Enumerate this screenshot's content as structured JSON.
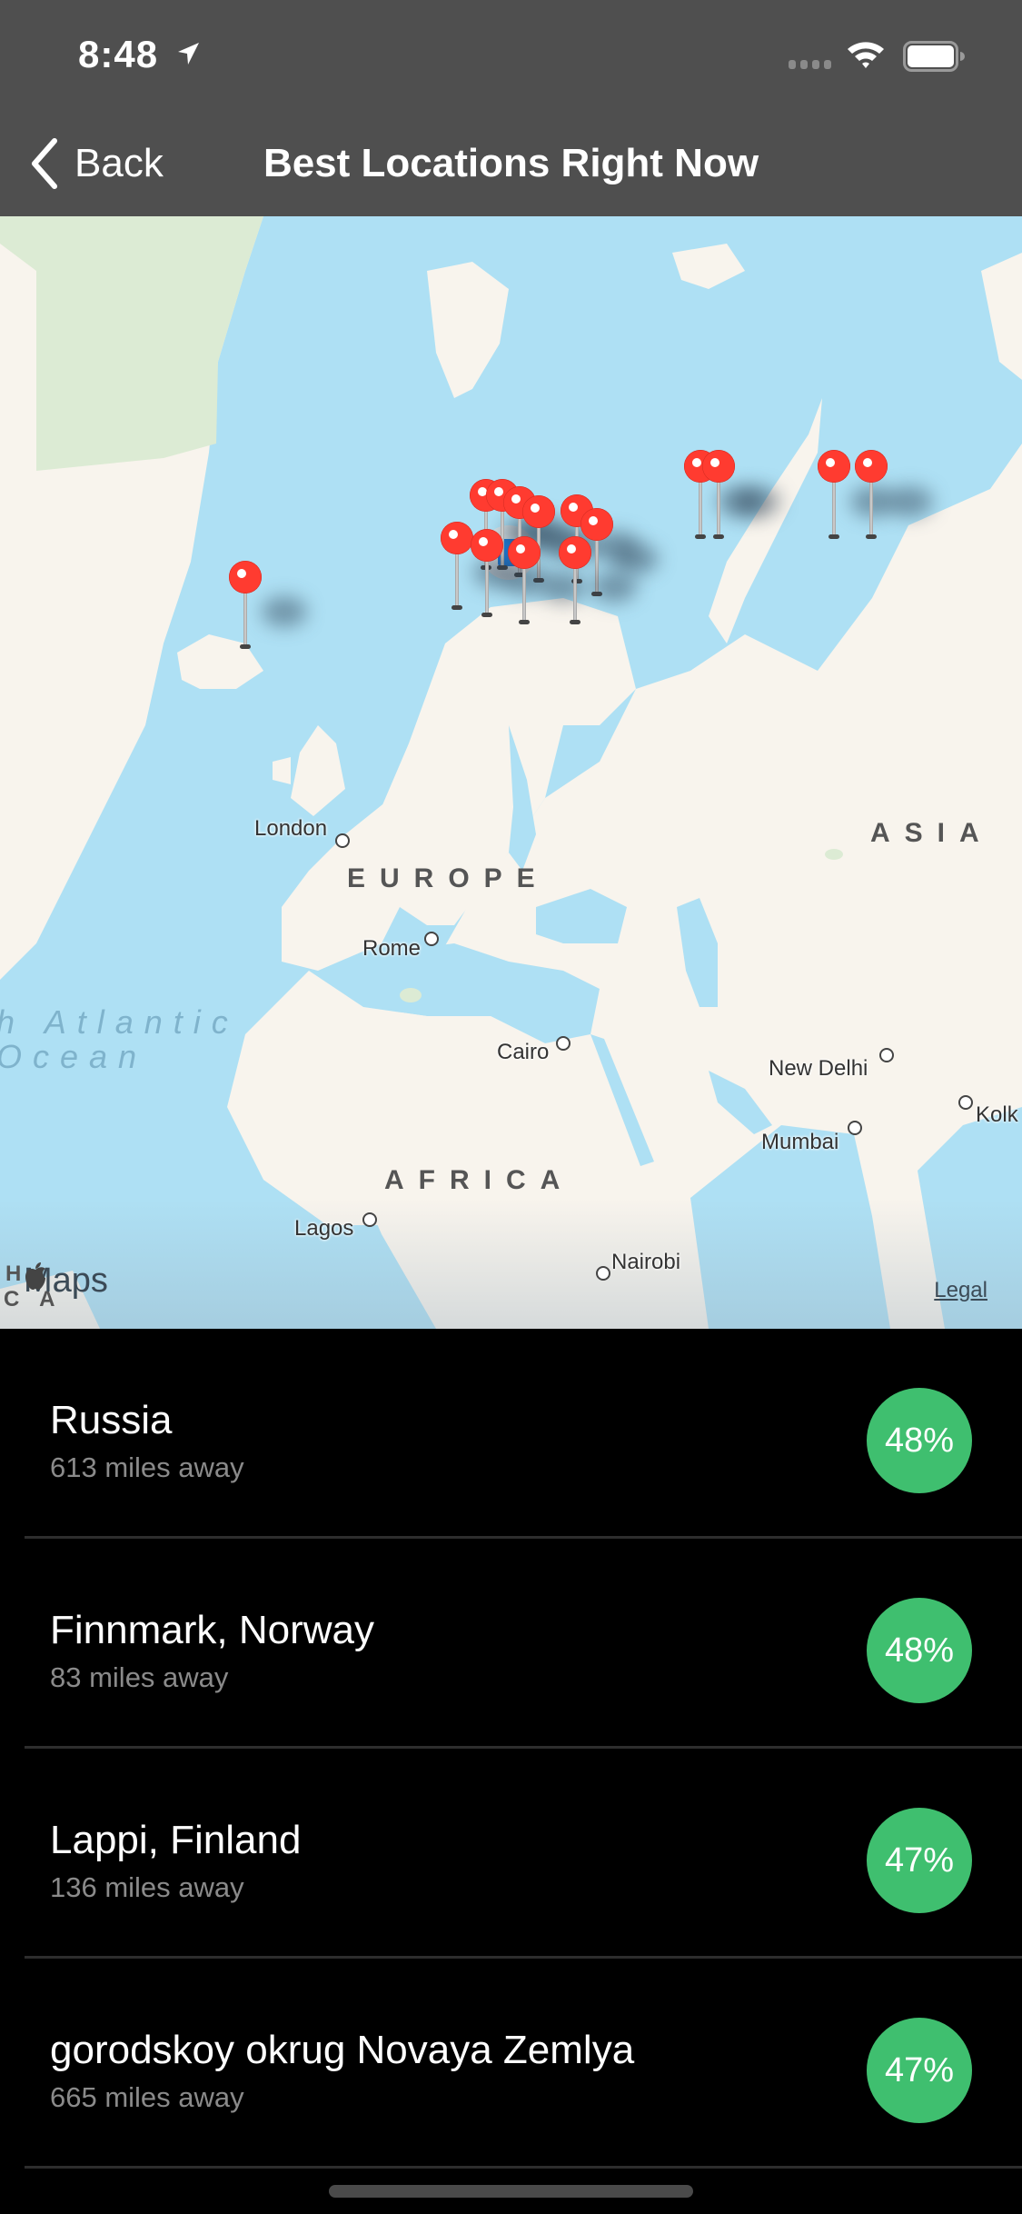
{
  "status_bar": {
    "time": "8:48",
    "location_icon": "location-arrow-icon",
    "signal_icon": "cellular-signal-icon",
    "wifi_icon": "wifi-icon",
    "battery_icon": "battery-icon"
  },
  "nav": {
    "back_label": "Back",
    "back_icon": "chevron-left-icon",
    "title": "Best Locations Right Now"
  },
  "map": {
    "attribution": "Maps",
    "legal_label": "Legal",
    "continents": [
      "EUROPE",
      "ASIA",
      "AFRICA"
    ],
    "ocean_lines": [
      "h Atlantic",
      "Ocean"
    ],
    "edge_labels": [
      "H",
      "C A"
    ],
    "cities": [
      "London",
      "Rome",
      "Cairo",
      "New Delhi",
      "Mumbai",
      "Kolk",
      "Lagos",
      "Nairobi"
    ],
    "pin_count": 15,
    "colors": {
      "water": "#aee0f4",
      "land": "#f8f4ed",
      "park": "#dcebd4",
      "pin": "#ff3b30"
    }
  },
  "locations": [
    {
      "name": "Russia",
      "distance": "613 miles away",
      "score": "48%"
    },
    {
      "name": "Finnmark, Norway",
      "distance": "83 miles away",
      "score": "48%"
    },
    {
      "name": "Lappi, Finland",
      "distance": "136 miles away",
      "score": "47%"
    },
    {
      "name": "gorodskoy okrug Novaya Zemlya",
      "distance": "665 miles away",
      "score": "47%"
    }
  ],
  "colors": {
    "header": "#4f4f4f",
    "badge": "#3fbf6f",
    "background": "#000000"
  }
}
